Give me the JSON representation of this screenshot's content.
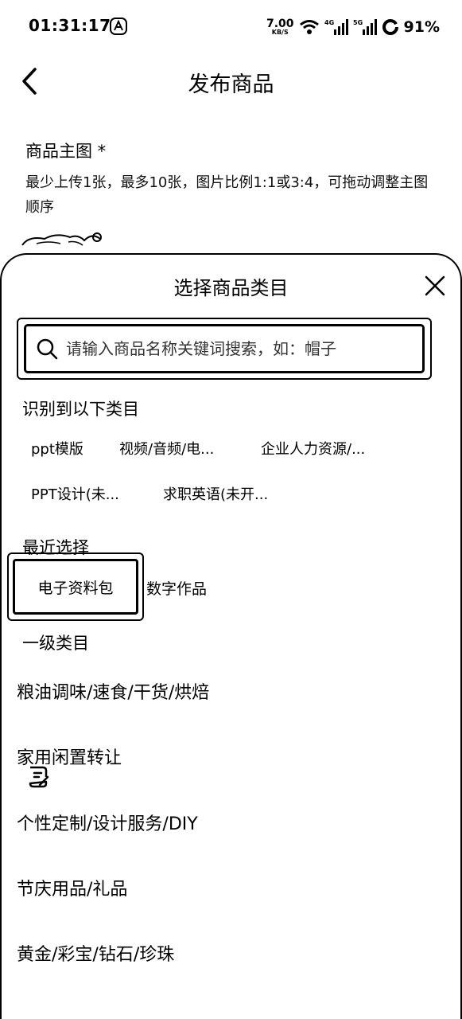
{
  "status_bar": {
    "time": "01:31:17",
    "net_speed_value": "7.00",
    "net_speed_unit": "KB/S",
    "signal1": "4G",
    "signal2": "5G",
    "battery": "91%"
  },
  "page": {
    "title": "发布商品",
    "main_image_title": "商品主图 *",
    "main_image_hint": "最少上传1张，最多10张，图片比例1:1或3:4，可拖动调整主图顺序"
  },
  "sheet": {
    "title": "选择商品类目",
    "search_placeholder": "请输入商品名称关键词搜索，如：帽子",
    "recognized_heading": "识别到以下类目",
    "recognized": [
      "ppt模版",
      "视频/音频/电...",
      "企业人力资源/...",
      "PPT设计(未...",
      "求职英语(未开..."
    ],
    "recent_heading": "最近选择",
    "recent": [
      "电子资料包",
      "数字作品"
    ],
    "level1_heading": "一级类目",
    "level1": [
      "粮油调味/速食/干货/烘焙",
      "家用闲置转让",
      "个性定制/设计服务/DIY",
      "节庆用品/礼品",
      "黄金/彩宝/钻石/珍珠"
    ]
  },
  "icons": {
    "back": "chevron-left-icon",
    "close": "close-icon",
    "search": "search-icon",
    "floating": "note-edit-icon"
  }
}
